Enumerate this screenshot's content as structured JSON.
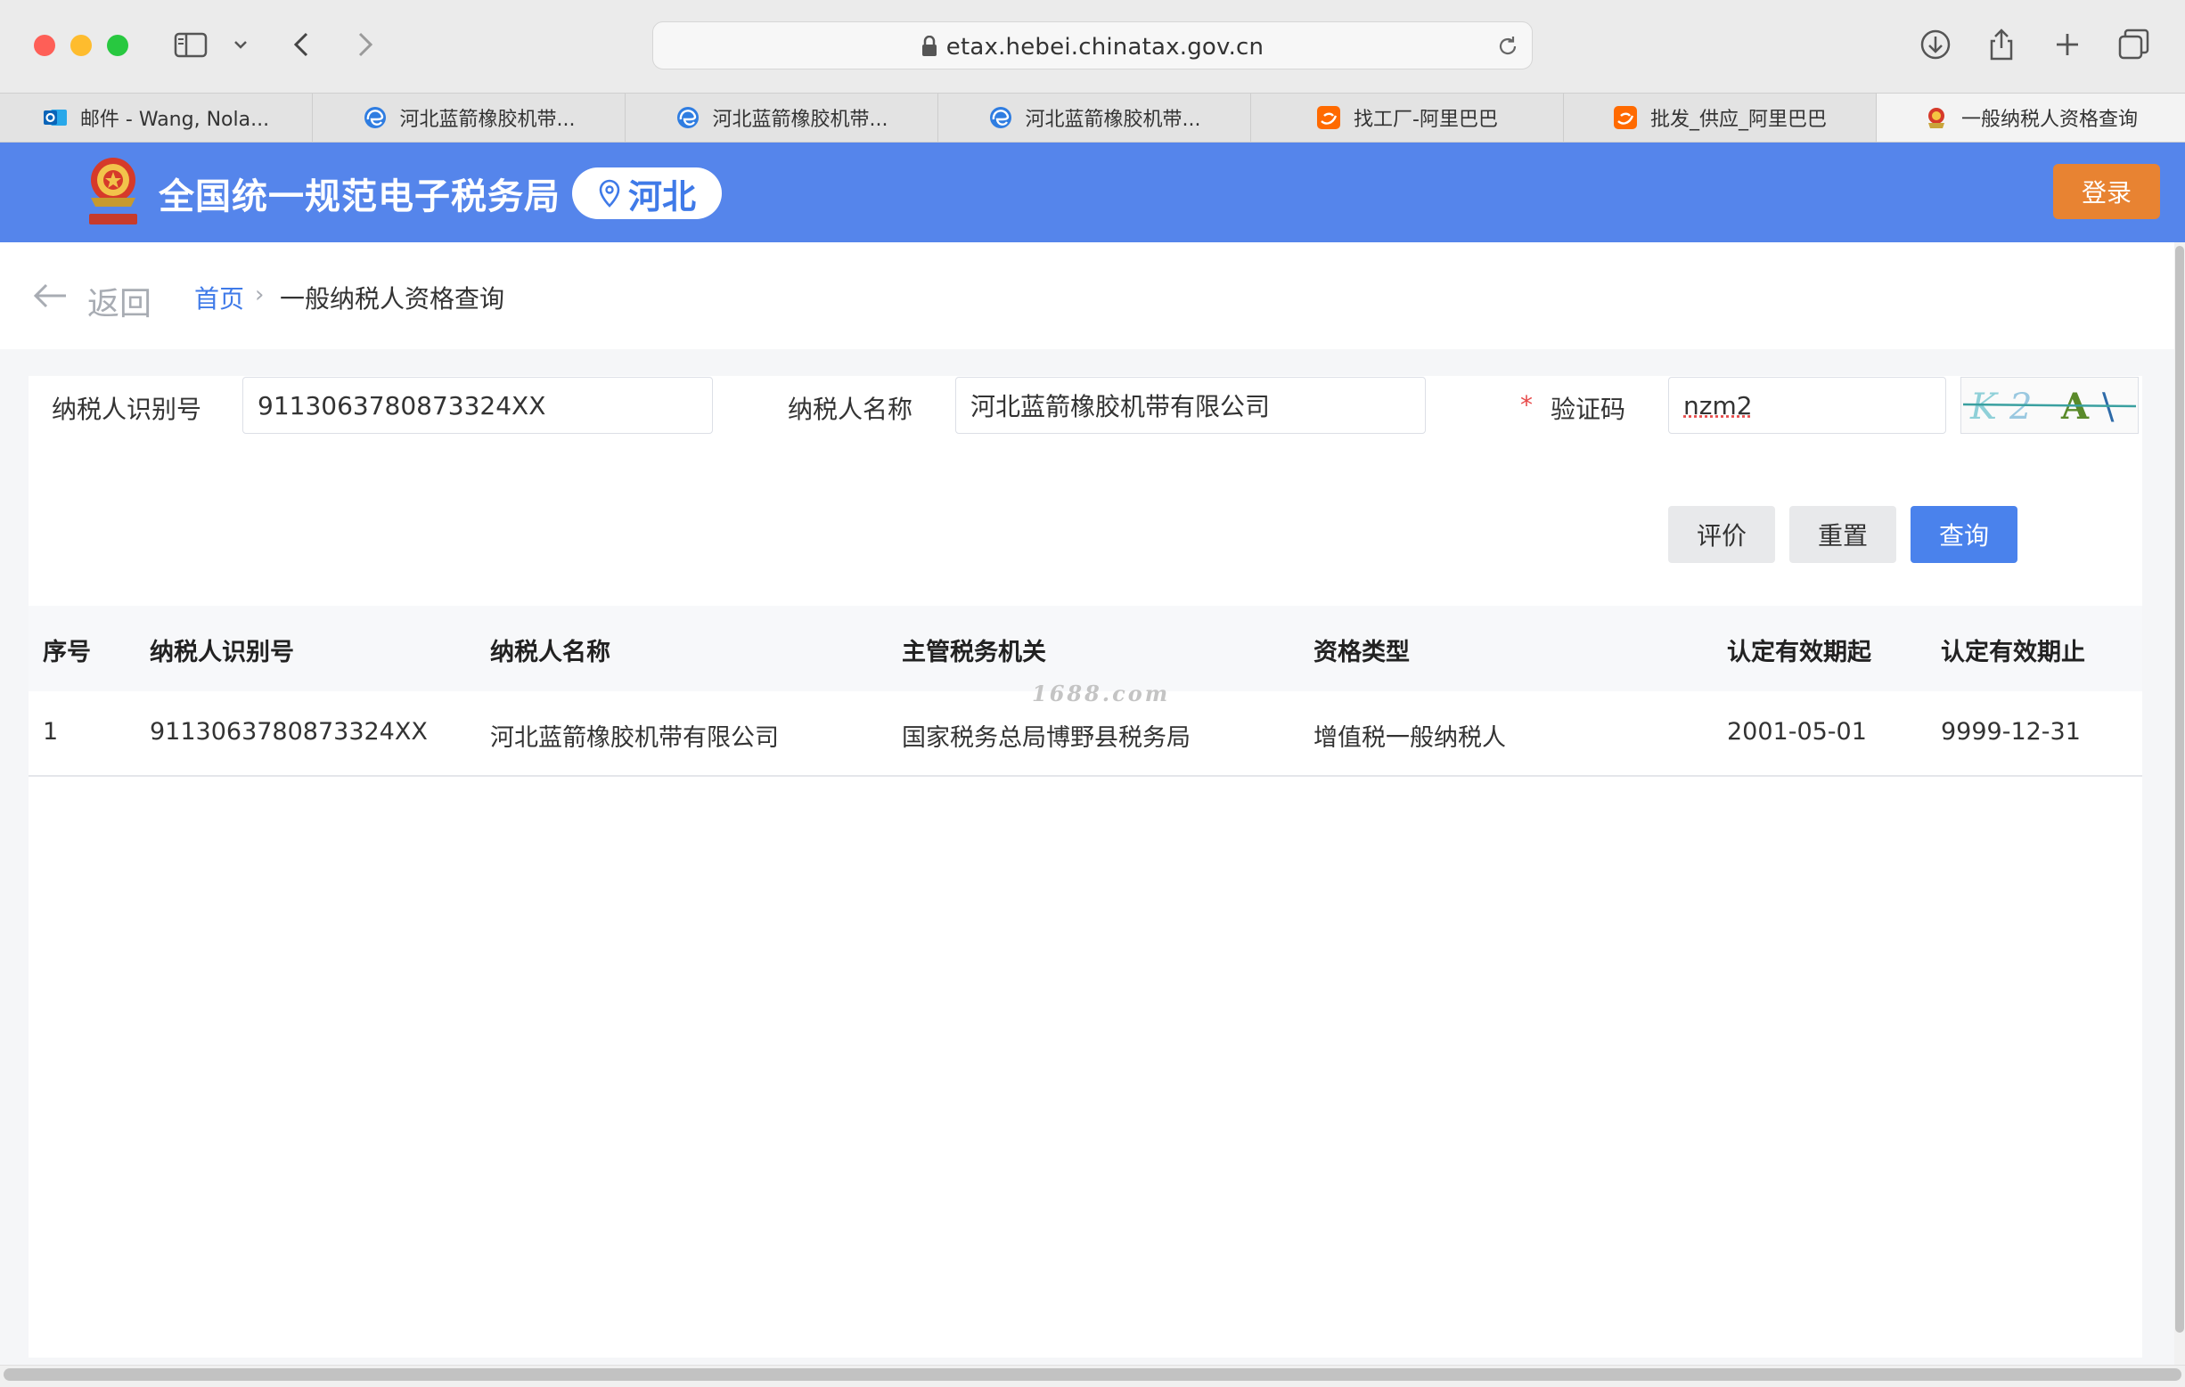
{
  "browser": {
    "url": "etax.hebei.chinatax.gov.cn",
    "tabs": [
      {
        "label": "邮件 - Wang, Nola...",
        "icon": "outlook-icon"
      },
      {
        "label": "河北蓝箭橡胶机带...",
        "icon": "edge-icon"
      },
      {
        "label": "河北蓝箭橡胶机带...",
        "icon": "edge-icon"
      },
      {
        "label": "河北蓝箭橡胶机带...",
        "icon": "edge-icon"
      },
      {
        "label": "找工厂-阿里巴巴",
        "icon": "alibaba-icon"
      },
      {
        "label": "批发_供应_阿里巴巴",
        "icon": "alibaba-icon"
      },
      {
        "label": "一般纳税人资格查询",
        "icon": "tax-emblem-icon",
        "active": true
      }
    ]
  },
  "header": {
    "site_title": "全国统一规范电子税务局",
    "region": "河北",
    "login_label": "登录",
    "colors": {
      "bar": "#5585eb",
      "login": "#e88332"
    }
  },
  "breadcrumb": {
    "back_label": "返回",
    "home": "首页",
    "separator": "›",
    "current": "一般纳税人资格查询"
  },
  "form": {
    "taxpayer_id_label": "纳税人识别号",
    "taxpayer_id_value": "9113063780873324XX",
    "taxpayer_name_label": "纳税人名称",
    "taxpayer_name_value": "河北蓝箭橡胶机带有限公司",
    "required_mark": "*",
    "captcha_label": "验证码",
    "captcha_value": "nzm2",
    "captcha_image_text": "K2A\\",
    "buttons": {
      "evaluate": "评价",
      "reset": "重置",
      "query": "查询"
    }
  },
  "table": {
    "headers": [
      "序号",
      "纳税人识别号",
      "纳税人名称",
      "主管税务机关",
      "资格类型",
      "认定有效期起",
      "认定有效期止"
    ],
    "rows": [
      [
        "1",
        "9113063780873324XX",
        "河北蓝箭橡胶机带有限公司",
        "国家税务总局博野县税务局",
        "增值税一般纳税人",
        "2001-05-01",
        "9999-12-31"
      ]
    ]
  },
  "watermark": "1688.com"
}
